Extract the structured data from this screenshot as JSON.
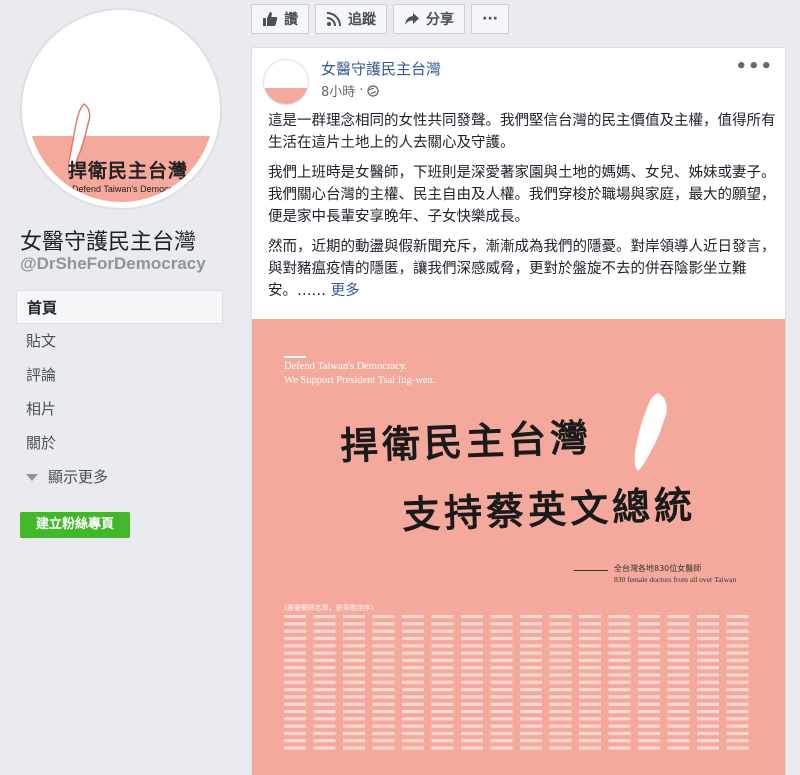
{
  "sidebar": {
    "avatar": {
      "logo_text": "捍衛民主台灣",
      "logo_subtitle": "Defend Taiwan's Democracy"
    },
    "page_name": "女醫守護民主台灣",
    "page_handle": "@DrSheForDemocracy",
    "nav": [
      {
        "label": "首頁",
        "active": true
      },
      {
        "label": "貼文",
        "active": false
      },
      {
        "label": "評論",
        "active": false
      },
      {
        "label": "相片",
        "active": false
      },
      {
        "label": "關於",
        "active": false
      }
    ],
    "show_more": "顯示更多",
    "create_page_button": "建立粉絲專頁"
  },
  "action_bar": {
    "like": "讚",
    "follow": "追蹤",
    "share": "分享",
    "more": "···"
  },
  "post": {
    "author": "女醫守護民主台灣",
    "time": "8小時",
    "audience_icon": "globe-icon",
    "menu": "•••",
    "paragraphs": [
      "這是一群理念相同的女性共同發聲。我們堅信台灣的民主價值及主權，值得所有生活在這片土地上的人去關心及守護。",
      "我們上班時是女醫師，下班則是深愛著家園與土地的媽媽、女兒、姊妹或妻子。我們關心台灣的主權、民主自由及人權。我們穿梭於職場與家庭，最大的願望，便是家中長輩安享晚年、子女快樂成長。",
      "然而，近期的動盪與假新聞充斥，漸漸成為我們的隱憂。對岸領導人近日發言，與對豬瘟疫情的隱匿，讓我們深感威脅，更對於盤旋不去的併吞陰影坐立難安。……"
    ],
    "see_more": "更多",
    "image": {
      "background_color": "#f4a99c",
      "english_line1": "Defend Taiwan's Democracy.",
      "english_line2": "We Support President Tsai Ing-wen.",
      "headline1": "捍衛民主台灣",
      "headline2": "支持蔡英文總統",
      "signature_zh": "全台灣各地830位女醫師",
      "signature_en": "830 female doctors from all over Taiwan",
      "names_header": "(連署醫師名單，依筆劃排序)"
    }
  },
  "colors": {
    "link": "#365899",
    "green": "#42b72a",
    "pink": "#f4a99c"
  }
}
